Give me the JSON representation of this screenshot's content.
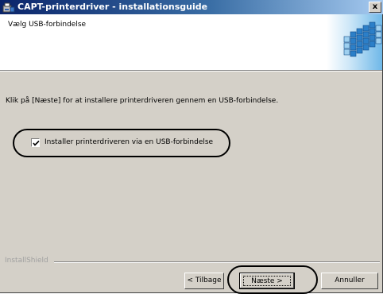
{
  "window": {
    "title": "CAPT-printerdriver - installationsguide",
    "close_glyph": "x"
  },
  "header": {
    "title": "Vælg USB-forbindelse",
    "graphic_icon": "printer-cube-graphic"
  },
  "body": {
    "instruction": "Klik på [Næste] for at installere printerdriveren gennem en USB-forbindelse.",
    "checkbox": {
      "label": "Installer printerdriveren via en USB-forbindelse",
      "checked": true
    }
  },
  "footer": {
    "brand": "InstallShield",
    "back_label": "< Tilbage",
    "next_label": "Næste >",
    "cancel_label": "Annuller"
  },
  "colors": {
    "titlebar_start": "#0a246a",
    "titlebar_end": "#a6caf0",
    "dialog_bg": "#d4d0c8"
  }
}
